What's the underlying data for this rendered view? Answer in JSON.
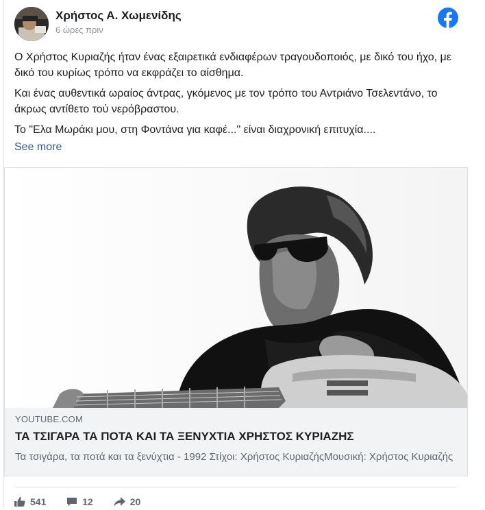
{
  "post": {
    "author": "Χρήστος Α. Χωμενίδης",
    "timestamp": "6 ώρες πριν",
    "paragraphs": [
      "Ο Χρήστος Κυριαζής ήταν ένας εξαιρετικά ενδιαφέρων τραγουδοποιός, με δικό του ήχο, με δικό του κυρίως τρόπο να εκφράζει το αίσθημα.",
      "Και ένας αυθεντικά ωραίος άντρας, γκόμενος με τον τρόπο του Αντριάνο Τσελεντάνο, το άκρως αντίθετο τού νερόβραστου.",
      "Το \"Ελα Μωράκι μου, στη Φοντάνα για καφέ...\" είναι διαχρονική επιτυχία...."
    ],
    "see_more": "See more"
  },
  "link": {
    "domain": "YOUTUBE.COM",
    "title": "ΤΑ ΤΣΙΓΑΡΑ ΤΑ ΠΟΤΑ ΚΑΙ ΤΑ ΞΕΝΥΧΤΙΑ ΧΡΗΣΤΟΣ ΚΥΡΙΑΖΗΣ",
    "description": "Τα τσιγάρα, τα ποτά και τα ξενύχτια - 1992 Στίχοι: Χρήστος ΚυριαζήςΜουσική: Χρήστος Κυριαζής"
  },
  "stats": {
    "likes": "541",
    "comments": "12",
    "shares": "20"
  },
  "icons": {
    "facebook_logo": "facebook-logo-icon",
    "like": "thumbs-up-icon",
    "comment": "comment-bubble-icon",
    "share": "share-arrow-icon"
  },
  "colors": {
    "facebook_blue": "#1877f2",
    "link_blue": "#365899",
    "muted": "#606770"
  }
}
